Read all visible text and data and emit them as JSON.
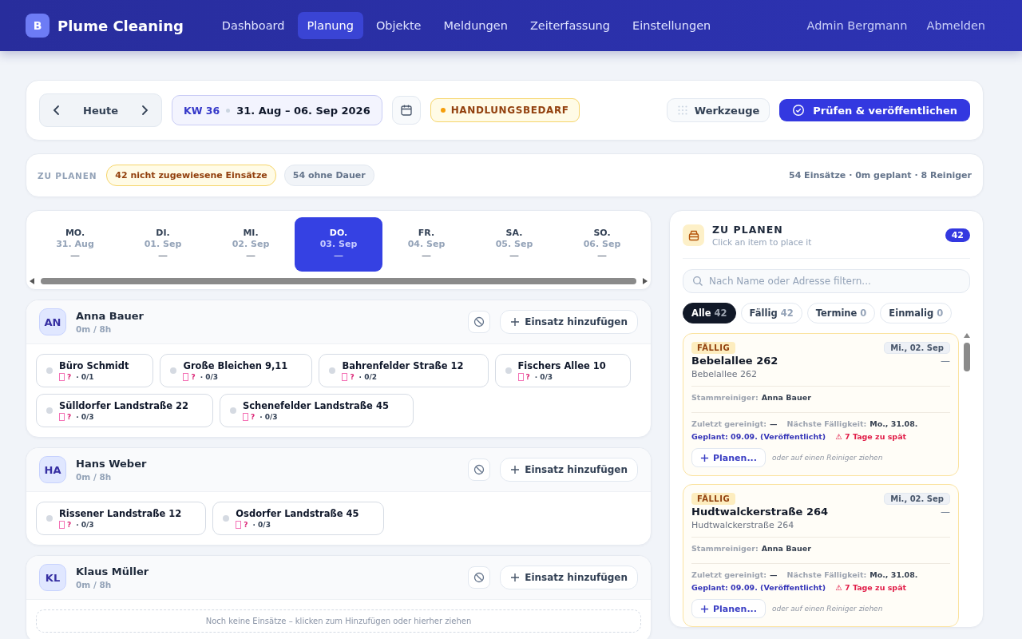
{
  "app": {
    "logo_letter": "B",
    "name": "Plume Cleaning"
  },
  "nav": [
    {
      "label": "Dashboard",
      "selected": false
    },
    {
      "label": "Planung",
      "selected": true
    },
    {
      "label": "Objekte",
      "selected": false
    },
    {
      "label": "Meldungen",
      "selected": false
    },
    {
      "label": "Zeiterfassung",
      "selected": false
    },
    {
      "label": "Einstellungen",
      "selected": false
    }
  ],
  "user": {
    "name": "Admin Bergmann",
    "logout": "Abmelden"
  },
  "toolbar": {
    "today": "Heute",
    "week": "KW 36",
    "range": "31. Aug – 06. Sep 2026",
    "status": "HANDLUNGSBEDARF",
    "tools": "Werkzeuge",
    "publish": "Prüfen & veröffentlichen"
  },
  "summary": {
    "label": "ZU PLANEN",
    "unassigned": "42 nicht zugewiesene Einsätze",
    "no_duration": "54 ohne Dauer",
    "stats": "54 Einsätze · 0m geplant · 8 Reiniger"
  },
  "days": [
    {
      "weekday": "MO.",
      "date": "31. Aug",
      "load": "—",
      "selected": false
    },
    {
      "weekday": "DI.",
      "date": "01. Sep",
      "load": "—",
      "selected": false
    },
    {
      "weekday": "MI.",
      "date": "02. Sep",
      "load": "—",
      "selected": false
    },
    {
      "weekday": "DO.",
      "date": "03. Sep",
      "load": "—",
      "selected": true
    },
    {
      "weekday": "FR.",
      "date": "04. Sep",
      "load": "—",
      "selected": false
    },
    {
      "weekday": "SA.",
      "date": "05. Sep",
      "load": "—",
      "selected": false
    },
    {
      "weekday": "SO.",
      "date": "06. Sep",
      "load": "—",
      "selected": false
    }
  ],
  "cleaners": [
    {
      "initials": "AN",
      "name": "Anna Bauer",
      "hours": "0m / 8h",
      "add": "Einsatz hinzufügen",
      "tasks": [
        {
          "name": "Büro Schmidt",
          "duration": "?",
          "count": "· 0/1"
        },
        {
          "name": "Große Bleichen 9,11",
          "duration": "?",
          "count": "· 0/3"
        },
        {
          "name": "Bahrenfelder Straße 12",
          "duration": "?",
          "count": "· 0/2"
        },
        {
          "name": "Fischers Allee 10",
          "duration": "?",
          "count": "· 0/3"
        },
        {
          "name": "Sülldorfer Landstraße 22",
          "duration": "?",
          "count": "· 0/3"
        },
        {
          "name": "Schenefelder Landstraße 45",
          "duration": "?",
          "count": "· 0/3"
        }
      ]
    },
    {
      "initials": "HA",
      "name": "Hans Weber",
      "hours": "0m / 8h",
      "add": "Einsatz hinzufügen",
      "tasks": [
        {
          "name": "Rissener Landstraße 12",
          "duration": "?",
          "count": "· 0/3"
        },
        {
          "name": "Osdorfer Landstraße 45",
          "duration": "?",
          "count": "· 0/3"
        }
      ]
    },
    {
      "initials": "KL",
      "name": "Klaus Müller",
      "hours": "0m / 8h",
      "add": "Einsatz hinzufügen",
      "empty": "Noch keine Einsätze – klicken zum Hinzufügen oder hierher ziehen"
    }
  ],
  "queue": {
    "title": "ZU PLANEN",
    "subtitle": "Click an item to place it",
    "count": "42",
    "search_placeholder": "Nach Name oder Adresse filtern...",
    "filters": [
      {
        "label": "Alle",
        "count": "42",
        "selected": true
      },
      {
        "label": "Fällig",
        "count": "42",
        "selected": false
      },
      {
        "label": "Termine",
        "count": "0",
        "selected": false
      },
      {
        "label": "Einmalig",
        "count": "0",
        "selected": false
      }
    ],
    "items": [
      {
        "status": "FÄLLIG",
        "date": "Mi., 02. Sep",
        "title": "Bebelallee 262",
        "address": "Bebelallee 262",
        "duration": "—",
        "regular_label": "Stammreiniger:",
        "regular": "Anna Bauer",
        "last_label": "Zuletzt gereinigt:",
        "last": "—",
        "next_label": "Nächste Fälligkeit:",
        "next": "Mo., 31.08.",
        "planned": "Geplant: 09.09. (Veröffentlicht)",
        "late": "⚠ 7 Tage zu spät",
        "plan": "Planen...",
        "hint": "oder auf einen Reiniger ziehen"
      },
      {
        "status": "FÄLLIG",
        "date": "Mi., 02. Sep",
        "title": "Hudtwalckerstraße 264",
        "address": "Hudtwalckerstraße 264",
        "duration": "—",
        "regular_label": "Stammreiniger:",
        "regular": "Anna Bauer",
        "last_label": "Zuletzt gereinigt:",
        "last": "—",
        "next_label": "Nächste Fälligkeit:",
        "next": "Mo., 31.08.",
        "planned": "Geplant: 09.09. (Veröffentlicht)",
        "late": "⚠ 7 Tage zu spät",
        "plan": "Planen...",
        "hint": "oder auf einen Reiniger ziehen"
      }
    ]
  }
}
